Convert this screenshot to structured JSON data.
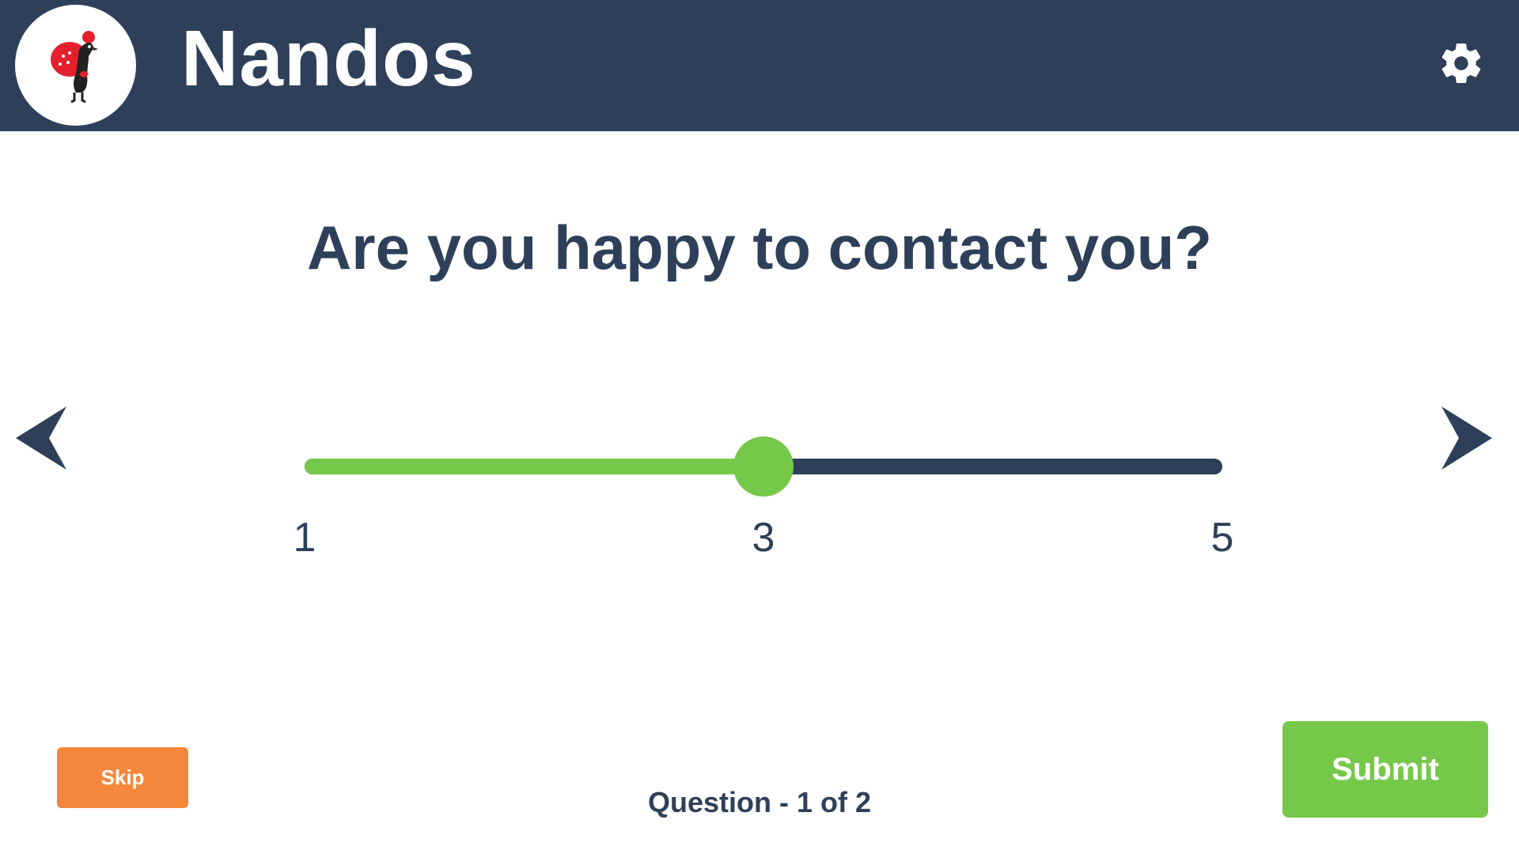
{
  "header": {
    "brand": "Nandos",
    "logo_icon": "rooster-logo-icon",
    "settings_icon": "gear-icon"
  },
  "question": {
    "text": "Are you happy to contact you?"
  },
  "navigation": {
    "prev_icon": "chevron-left-icon",
    "next_icon": "chevron-right-icon"
  },
  "slider": {
    "min": 1,
    "max": 5,
    "value": 3,
    "labels": {
      "min": "1",
      "value": "3",
      "max": "5"
    }
  },
  "footer": {
    "skip_label": "Skip",
    "submit_label": "Submit",
    "progress_text": "Question - 1 of 2"
  },
  "colors": {
    "header_bg": "#2e4059",
    "accent_green": "#76c84a",
    "skip_orange": "#f5873c",
    "text_dark": "#2e4059"
  }
}
